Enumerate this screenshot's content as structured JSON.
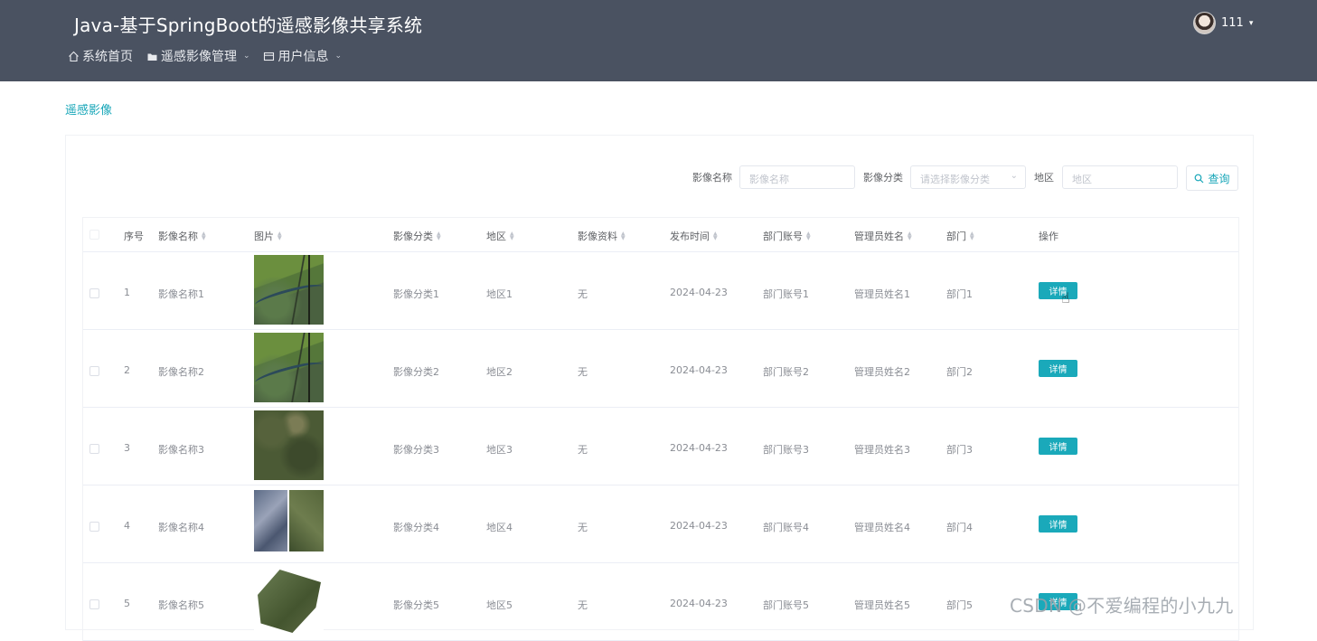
{
  "header": {
    "title": "Java-基于SpringBoot的遥感影像共享系统",
    "nav": [
      {
        "label": "系统首页",
        "icon": "home-icon",
        "has_dropdown": false
      },
      {
        "label": "遥感影像管理",
        "icon": "folder-icon",
        "has_dropdown": true
      },
      {
        "label": "用户信息",
        "icon": "card-icon",
        "has_dropdown": true
      }
    ],
    "user": {
      "name": "111"
    }
  },
  "breadcrumb": "遥感影像",
  "search": {
    "name_label": "影像名称",
    "name_placeholder": "影像名称",
    "category_label": "影像分类",
    "category_placeholder": "请选择影像分类",
    "region_label": "地区",
    "region_placeholder": "地区",
    "query_label": "查询"
  },
  "table": {
    "columns": [
      "序号",
      "影像名称",
      "图片",
      "影像分类",
      "地区",
      "影像资料",
      "发布时间",
      "部门账号",
      "管理员姓名",
      "部门",
      "操作"
    ],
    "rows": [
      {
        "index": "1",
        "name": "影像名称1",
        "category": "影像分类1",
        "region": "地区1",
        "material": "无",
        "date": "2024-04-23",
        "account": "部门账号1",
        "admin": "管理员姓名1",
        "dept": "部门1",
        "action": "详情",
        "thumb": "river-satellite"
      },
      {
        "index": "2",
        "name": "影像名称2",
        "category": "影像分类2",
        "region": "地区2",
        "material": "无",
        "date": "2024-04-23",
        "account": "部门账号2",
        "admin": "管理员姓名2",
        "dept": "部门2",
        "action": "详情",
        "thumb": "river-satellite"
      },
      {
        "index": "3",
        "name": "影像名称3",
        "category": "影像分类3",
        "region": "地区3",
        "material": "无",
        "date": "2024-04-23",
        "account": "部门账号3",
        "admin": "管理员姓名3",
        "dept": "部门3",
        "action": "详情",
        "thumb": "forest-satellite"
      },
      {
        "index": "4",
        "name": "影像名称4",
        "category": "影像分类4",
        "region": "地区4",
        "material": "无",
        "date": "2024-04-23",
        "account": "部门账号4",
        "admin": "管理员姓名4",
        "dept": "部门4",
        "action": "详情",
        "thumb": "split-satellite"
      },
      {
        "index": "5",
        "name": "影像名称5",
        "category": "影像分类5",
        "region": "地区5",
        "material": "无",
        "date": "2024-04-23",
        "account": "部门账号5",
        "admin": "管理员姓名5",
        "dept": "部门5",
        "action": "详情",
        "thumb": "cropped-satellite"
      }
    ]
  },
  "watermark": "CSDN @不爱编程的小九九",
  "colors": {
    "header_bg": "#4a5261",
    "accent": "#1aa9ba"
  }
}
